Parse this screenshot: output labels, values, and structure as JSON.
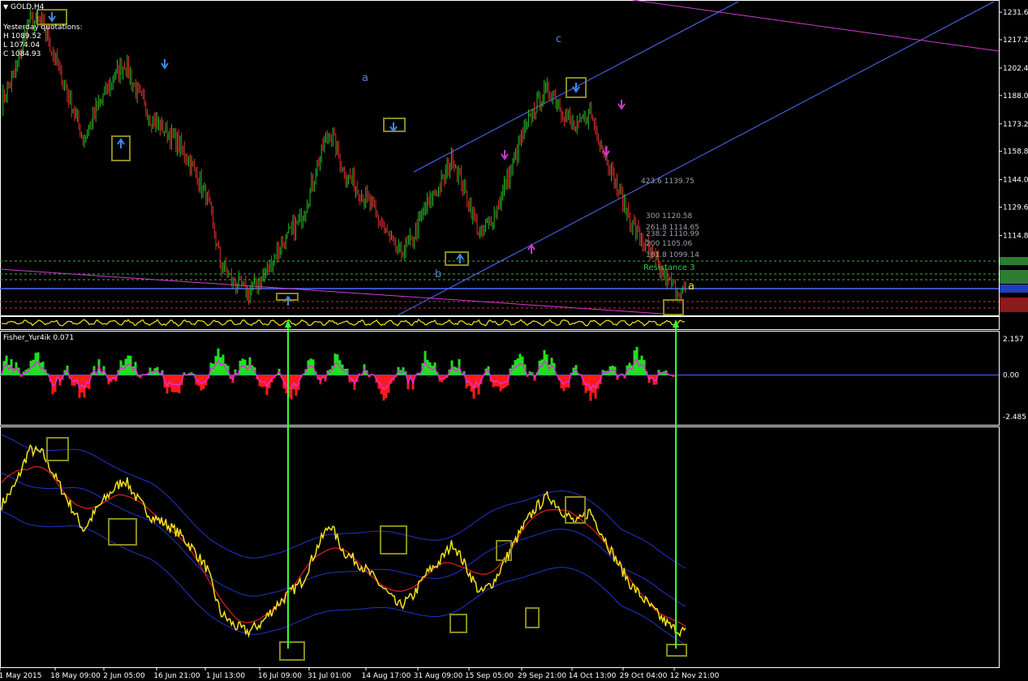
{
  "window": {
    "symbol_title": "GOLD,H4",
    "quotes_heading": "Yesterday quotations:",
    "quote_high": "H 1089.52",
    "quote_low": "L 1074.04",
    "quote_close": "C 1084.93"
  },
  "indicators": {
    "fisher_label": "Fisher_Yur4ik 0.071",
    "fisher_levels": [
      "2.157",
      "0.00",
      "-2.485"
    ]
  },
  "annotations": {
    "wave_a": "a",
    "wave_b": "b",
    "wave_c": "c",
    "wave_a_end": "a",
    "resistance_label": "Resistance 3",
    "fib_labels": [
      "423.6 1139.75",
      "300 1120.58",
      "261.8 1114.65",
      "238.2 1110.99",
      "200 1105.06",
      "161.8 1099.14"
    ]
  },
  "colors": {
    "background": "#000000",
    "price_line": "#f5e31c",
    "bull_candle": "#21c421",
    "bear_candle": "#e03030",
    "channel_line": "#4f6bff",
    "magenta_line": "#d23bd2",
    "marker_box": "#8a8a1e",
    "arrow_connector": "#33ff33",
    "fisher_positive": "#1ee01e",
    "fisher_negative": "#ff1a1a",
    "fisher_line": "#e02ee0",
    "bollinger": "#2233cc",
    "ma_red": "#d81c1c",
    "grid_text": "#ffffff"
  },
  "chart_data": [
    {
      "type": "candlestick",
      "title": "GOLD,H4",
      "y_ticks": [
        "1231.60",
        "1217.20",
        "1202.40",
        "1188.00",
        "1173.20",
        "1158.80",
        "1144.00",
        "1129.60",
        "1114.80"
      ],
      "ylim": [
        1073,
        1238
      ],
      "x_ticks": [
        "1 May 2015",
        "18 May 09:00",
        "2 Jun 05:00",
        "16 Jun 21:00",
        "1 Jul 13:00",
        "16 Jul 09:00",
        "31 Jul 01:00",
        "14 Aug 17:00",
        "31 Aug 09:00",
        "15 Sep 05:00",
        "29 Sep 21:00",
        "14 Oct 13:00",
        "29 Oct 04:00",
        "12 Nov 21:00"
      ],
      "approx_closes": [
        1185,
        1200,
        1228,
        1225,
        1205,
        1185,
        1165,
        1182,
        1195,
        1205,
        1188,
        1175,
        1170,
        1162,
        1150,
        1135,
        1100,
        1090,
        1085,
        1092,
        1105,
        1115,
        1125,
        1150,
        1170,
        1148,
        1140,
        1130,
        1118,
        1105,
        1112,
        1130,
        1140,
        1155,
        1135,
        1115,
        1125,
        1145,
        1165,
        1182,
        1192,
        1180,
        1170,
        1180,
        1160,
        1140,
        1122,
        1110,
        1098,
        1088,
        1085
      ]
    },
    {
      "type": "line",
      "title": "Fisher_Yur4ik 0.071",
      "y_ticks": [
        "2.157",
        "0.00",
        "-2.485"
      ],
      "ylim": [
        -2.485,
        2.157
      ]
    },
    {
      "type": "line",
      "title": "",
      "x_ticks": [
        "1 May 2015",
        "18 May 09:00",
        "2 Jun 05:00",
        "16 Jun 21:00",
        "1 Jul 13:00",
        "16 Jul 09:00",
        "31 Jul 01:00",
        "14 Aug 17:00",
        "31 Aug 09:00",
        "15 Sep 05:00",
        "29 Sep 21:00",
        "14 Oct 13:00",
        "29 Oct 04:00",
        "12 Nov 21:00"
      ]
    }
  ]
}
